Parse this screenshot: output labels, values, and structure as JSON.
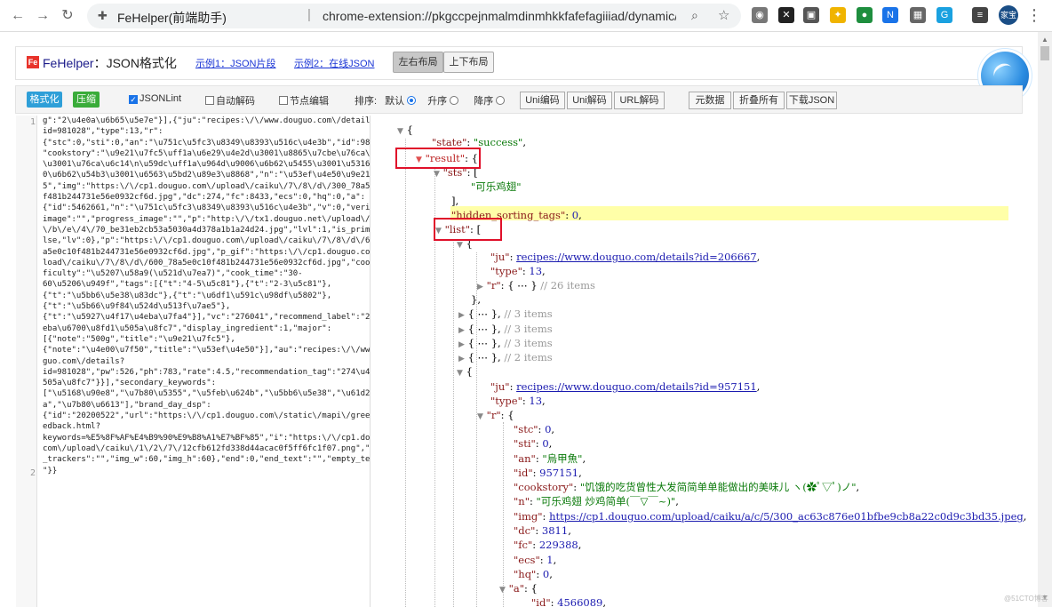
{
  "browser": {
    "tab_title": "FeHelper(前端助手)",
    "separator": "|",
    "url": "chrome-extension://pkgccpejnmalmdinmhkkfafefagiiiad/dynamic/index.html?t...",
    "avatar_text": "家宝"
  },
  "header": {
    "logo_text": "Fe",
    "brand": "FeHelper",
    "title_suffix": "：JSON格式化",
    "example1": "示例1：JSON片段",
    "example2": "示例2：在线JSON",
    "layout_lr": "左右布局",
    "layout_tb": "上下布局"
  },
  "toolbar": {
    "format": "格式化",
    "compress": "压缩",
    "jsonlint": "JSONLint",
    "auto_decode": "自动解码",
    "node_edit": "节点编辑",
    "sort_label": "排序:",
    "sort_default": "默认",
    "sort_asc": "升序",
    "sort_desc": "降序",
    "uni_encode": "Uni编码",
    "uni_decode": "Uni解码",
    "url_decode": "URL解码",
    "raw_data": "元数据",
    "fold_all": "折叠所有",
    "download": "下载JSON"
  },
  "editor": {
    "line_numbers": [
      "1",
      "2"
    ],
    "raw_lines": [
      "g\":\"2\\u4e0a\\u6b65\\u5e7e\"}],{\"ju\":\"recipes:\\/\\/www.douguo.com\\/details?",
      "id=981028\",\"type\":13,\"r\":",
      "{\"stc\":0,\"sti\":0,\"an\":\"\\u751c\\u5fc3\\u8349\\u8393\\u516c\\u4e3b\",\"id\":981028,",
      "\"cookstory\":\"\\u9e21\\u7fc5\\uff1a\\u6e29\\u4e2d\\u3001\\u8865\\u7cbe\\u76ca\\u9ad3",
      "\\u3001\\u76ca\\u6c14\\n\\u59dc\\uff1a\\u964d\\u9006\\u6b62\\u5455\\u3001\\u5316\\u75f",
      "0\\u6b62\\u54b3\\u3001\\u6563\\u5bd2\\u89e3\\u8868\",\"n\":\"\\u53ef\\u4e50\\u9e21\\u7fc",
      "5\",\"img\":\"https:\\/\\/cp1.douguo.com\\/upload\\/caiku\\/7\\/8\\/d\\/300_78a5e0c10",
      "f481b244731e56e0932cf6d.jpg\",\"dc\":274,\"fc\":8433,\"ecs\":0,\"hq\":0,\"a\":",
      "{\"id\":5462661,\"n\":\"\\u751c\\u5fc3\\u8349\\u8393\\u516c\\u4e3b\",\"v\":0,\"verified_",
      "image\":\"\",\"progress_image\":\"\",\"p\":\"http:\\/\\/tx1.douguo.net\\/upload\\/photo",
      "\\/b\\/e\\/4\\/70_be31eb2cb53a5030a4d378a1b1a24d24.jpg\",\"lvl\":1,\"is_prime\":fa",
      "lse,\"lv\":0},\"p\":\"https:\\/\\/cp1.douguo.com\\/upload\\/caiku\\/7\\/8\\/d\\/600_78",
      "a5e0c10f481b244731e56e0932cf6d.jpg\",\"p_gif\":\"https:\\/\\/cp1.douguo.com\\/up",
      "load\\/caiku\\/7\\/8\\/d\\/600_78a5e0c10f481b244731e56e0932cf6d.jpg\",\"cook_dif",
      "ficulty\":\"\\u5207\\u58a9(\\u521d\\u7ea7)\",\"cook_time\":\"30-",
      "60\\u5206\\u949f\",\"tags\":[{\"t\":\"4-5\\u5c81\"},{\"t\":\"2-3\\u5c81\"},",
      "{\"t\":\"\\u5bb6\\u5e38\\u83dc\"},{\"t\":\"\\u6df1\\u591c\\u98df\\u5802\"},",
      "{\"t\":\"\\u5b66\\u9f84\\u524d\\u513f\\u7ae5\"},",
      "{\"t\":\"\\u5927\\u4f17\\u4eba\\u7fa4\"}],\"vc\":\"276041\",\"recommend_label\":\"274\\u4",
      "eba\\u6700\\u8fd1\\u505a\\u8fc7\",\"display_ingredient\":1,\"major\":",
      "[{\"note\":\"500g\",\"title\":\"\\u9e21\\u7fc5\"},",
      "{\"note\":\"\\u4e00\\u7f50\",\"title\":\"\\u53ef\\u4e50\"}],\"au\":\"recipes:\\/\\/www.dou",
      "guo.com\\/details?",
      "id=981028\",\"pw\":526,\"ph\":783,\"rate\":4.5,\"recommendation_tag\":\"274\\u4eba\\u5",
      "505a\\u8fc7\"}}],\"secondary_keywords\":",
      "[\"\\u5168\\u90e8\",\"\\u7b80\\u5355\",\"\\u5feb\\u624b\",\"\\u5bb6\\u5e38\",\"\\u61d2\\u4eb",
      "a\",\"\\u7b80\\u6613\"],\"brand_day_dsp\":",
      "{\"id\":\"20200522\",\"url\":\"https:\\/\\/cp1.douguo.com\\/static\\/mapi\\/green\\/fe",
      "edback.html?",
      "keywords=%E5%8F%AF%E4%B9%90%E9%B8%A1%E7%BF%85\",\"i\":\"https:\\/\\/cp1.douguo.",
      "com\\/upload\\/caiku\\/1\\/2\\/7\\/12cfb612fd338d44acac0f5ff6fc1f07.png\",\"click",
      "_trackers\":\"\",\"img_w\":60,\"img_h\":60},\"end\":0,\"end_text\":\"\",\"empty_text\":\"",
      "\"}}"
    ]
  },
  "tree": {
    "l1": "{",
    "state_key": "\"state\"",
    "state_val": "\"success\"",
    "result_key": "\"result\"",
    "brace": "{",
    "sts_key": "\"sts\"",
    "bracket": "[",
    "sts_item": "\"可乐鸡翅\"",
    "bracket_close": "],",
    "hidden_key": "\"hidden_sorting_tags\"",
    "hidden_val": "0",
    "list_key": "\"list\"",
    "ju_key": "\"ju\"",
    "ju1_val": "recipes://www.douguo.com/details?id=206667",
    "type_key": "\"type\"",
    "type_val": "13",
    "r_key": "\"r\"",
    "collapsed": "{ ⋯ }",
    "r1_comment": "// 26 items",
    "close_comma": "},",
    "c3a": "// 3 items",
    "c3b": "// 3 items",
    "c3c": "// 3 items",
    "c2": "// 2 items",
    "ju2_val": "recipes://www.douguo.com/details?id=957151",
    "stc_key": "\"stc\"",
    "stc_val": "0",
    "sti_key": "\"sti\"",
    "sti_val": "0",
    "an_key": "\"an\"",
    "an_val": "\"烏甲魚\"",
    "id_key": "\"id\"",
    "id_val": "957151",
    "cookstory_key": "\"cookstory\"",
    "cookstory_val": "\"饥饿的吃货曾性大发简简单单能做出的美味儿 ヽ(✿ﾟ▽ﾟ)ノ\"",
    "n_key": "\"n\"",
    "n_val": "\"可乐鸡翅 炒鸡简单(￣▽￣~)\"",
    "img_key": "\"img\"",
    "img_val": "https://cp1.douguo.com/upload/caiku/a/c/5/300_ac63c876e01bfbe9cb8a22c0d9c3bd35.jpeg",
    "dc_key": "\"dc\"",
    "dc_val": "3811",
    "fc_key": "\"fc\"",
    "fc_val": "229388",
    "ecs_key": "\"ecs\"",
    "ecs_val": "1",
    "hq_key": "\"hq\"",
    "hq_val": "0",
    "a_key": "\"a\"",
    "a_id_key": "\"id\"",
    "a_id_val": "4566089"
  },
  "watermark": "@51CTO博客"
}
